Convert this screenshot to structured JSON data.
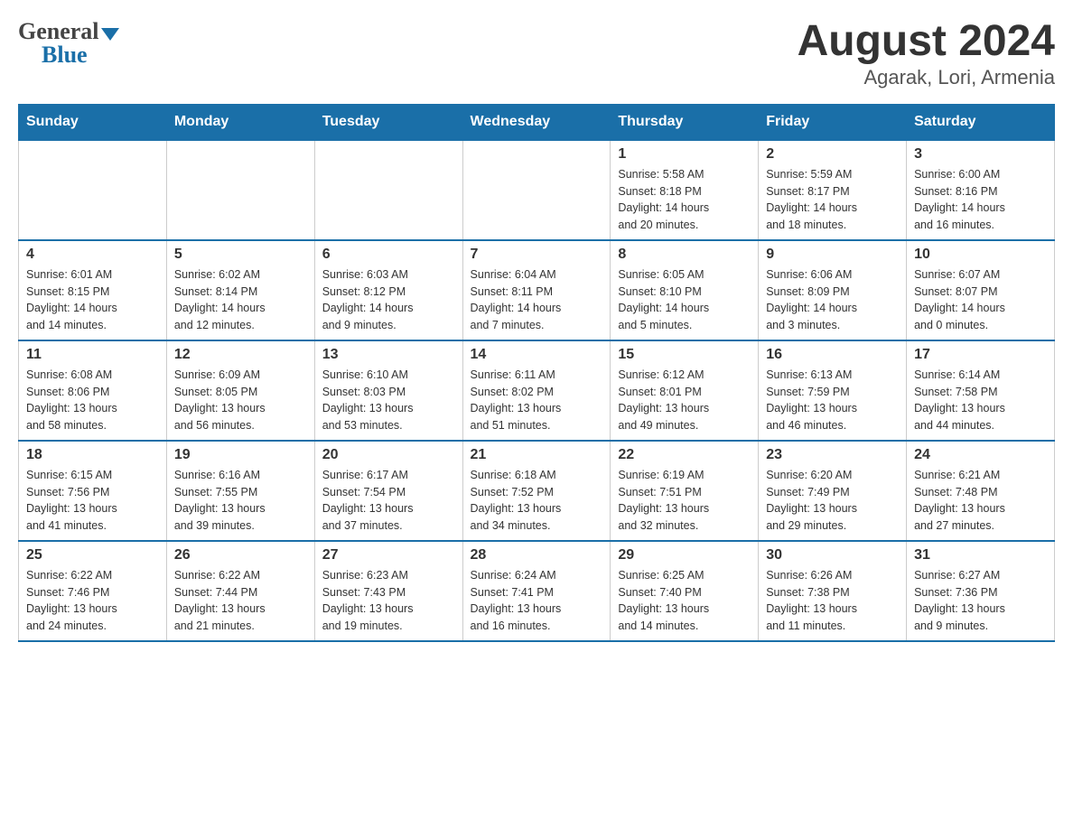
{
  "header": {
    "logo_general": "General",
    "logo_blue": "Blue",
    "title": "August 2024",
    "subtitle": "Agarak, Lori, Armenia"
  },
  "days_of_week": [
    "Sunday",
    "Monday",
    "Tuesday",
    "Wednesday",
    "Thursday",
    "Friday",
    "Saturday"
  ],
  "weeks": [
    [
      {
        "date": "",
        "info": ""
      },
      {
        "date": "",
        "info": ""
      },
      {
        "date": "",
        "info": ""
      },
      {
        "date": "",
        "info": ""
      },
      {
        "date": "1",
        "info": "Sunrise: 5:58 AM\nSunset: 8:18 PM\nDaylight: 14 hours\nand 20 minutes."
      },
      {
        "date": "2",
        "info": "Sunrise: 5:59 AM\nSunset: 8:17 PM\nDaylight: 14 hours\nand 18 minutes."
      },
      {
        "date": "3",
        "info": "Sunrise: 6:00 AM\nSunset: 8:16 PM\nDaylight: 14 hours\nand 16 minutes."
      }
    ],
    [
      {
        "date": "4",
        "info": "Sunrise: 6:01 AM\nSunset: 8:15 PM\nDaylight: 14 hours\nand 14 minutes."
      },
      {
        "date": "5",
        "info": "Sunrise: 6:02 AM\nSunset: 8:14 PM\nDaylight: 14 hours\nand 12 minutes."
      },
      {
        "date": "6",
        "info": "Sunrise: 6:03 AM\nSunset: 8:12 PM\nDaylight: 14 hours\nand 9 minutes."
      },
      {
        "date": "7",
        "info": "Sunrise: 6:04 AM\nSunset: 8:11 PM\nDaylight: 14 hours\nand 7 minutes."
      },
      {
        "date": "8",
        "info": "Sunrise: 6:05 AM\nSunset: 8:10 PM\nDaylight: 14 hours\nand 5 minutes."
      },
      {
        "date": "9",
        "info": "Sunrise: 6:06 AM\nSunset: 8:09 PM\nDaylight: 14 hours\nand 3 minutes."
      },
      {
        "date": "10",
        "info": "Sunrise: 6:07 AM\nSunset: 8:07 PM\nDaylight: 14 hours\nand 0 minutes."
      }
    ],
    [
      {
        "date": "11",
        "info": "Sunrise: 6:08 AM\nSunset: 8:06 PM\nDaylight: 13 hours\nand 58 minutes."
      },
      {
        "date": "12",
        "info": "Sunrise: 6:09 AM\nSunset: 8:05 PM\nDaylight: 13 hours\nand 56 minutes."
      },
      {
        "date": "13",
        "info": "Sunrise: 6:10 AM\nSunset: 8:03 PM\nDaylight: 13 hours\nand 53 minutes."
      },
      {
        "date": "14",
        "info": "Sunrise: 6:11 AM\nSunset: 8:02 PM\nDaylight: 13 hours\nand 51 minutes."
      },
      {
        "date": "15",
        "info": "Sunrise: 6:12 AM\nSunset: 8:01 PM\nDaylight: 13 hours\nand 49 minutes."
      },
      {
        "date": "16",
        "info": "Sunrise: 6:13 AM\nSunset: 7:59 PM\nDaylight: 13 hours\nand 46 minutes."
      },
      {
        "date": "17",
        "info": "Sunrise: 6:14 AM\nSunset: 7:58 PM\nDaylight: 13 hours\nand 44 minutes."
      }
    ],
    [
      {
        "date": "18",
        "info": "Sunrise: 6:15 AM\nSunset: 7:56 PM\nDaylight: 13 hours\nand 41 minutes."
      },
      {
        "date": "19",
        "info": "Sunrise: 6:16 AM\nSunset: 7:55 PM\nDaylight: 13 hours\nand 39 minutes."
      },
      {
        "date": "20",
        "info": "Sunrise: 6:17 AM\nSunset: 7:54 PM\nDaylight: 13 hours\nand 37 minutes."
      },
      {
        "date": "21",
        "info": "Sunrise: 6:18 AM\nSunset: 7:52 PM\nDaylight: 13 hours\nand 34 minutes."
      },
      {
        "date": "22",
        "info": "Sunrise: 6:19 AM\nSunset: 7:51 PM\nDaylight: 13 hours\nand 32 minutes."
      },
      {
        "date": "23",
        "info": "Sunrise: 6:20 AM\nSunset: 7:49 PM\nDaylight: 13 hours\nand 29 minutes."
      },
      {
        "date": "24",
        "info": "Sunrise: 6:21 AM\nSunset: 7:48 PM\nDaylight: 13 hours\nand 27 minutes."
      }
    ],
    [
      {
        "date": "25",
        "info": "Sunrise: 6:22 AM\nSunset: 7:46 PM\nDaylight: 13 hours\nand 24 minutes."
      },
      {
        "date": "26",
        "info": "Sunrise: 6:22 AM\nSunset: 7:44 PM\nDaylight: 13 hours\nand 21 minutes."
      },
      {
        "date": "27",
        "info": "Sunrise: 6:23 AM\nSunset: 7:43 PM\nDaylight: 13 hours\nand 19 minutes."
      },
      {
        "date": "28",
        "info": "Sunrise: 6:24 AM\nSunset: 7:41 PM\nDaylight: 13 hours\nand 16 minutes."
      },
      {
        "date": "29",
        "info": "Sunrise: 6:25 AM\nSunset: 7:40 PM\nDaylight: 13 hours\nand 14 minutes."
      },
      {
        "date": "30",
        "info": "Sunrise: 6:26 AM\nSunset: 7:38 PM\nDaylight: 13 hours\nand 11 minutes."
      },
      {
        "date": "31",
        "info": "Sunrise: 6:27 AM\nSunset: 7:36 PM\nDaylight: 13 hours\nand 9 minutes."
      }
    ]
  ]
}
